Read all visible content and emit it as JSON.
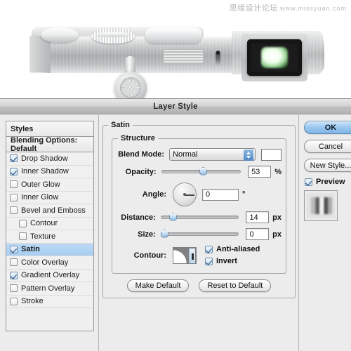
{
  "watermark": {
    "cn_text": "思缘设计论坛",
    "url_text": "www.missyuan.com"
  },
  "artwork": {
    "name": "silver-camera-photo",
    "description": "Silver compact camera top body with dials, strap lug and green-glowing viewfinder"
  },
  "dialog": {
    "title": "Layer Style",
    "styles_panel": {
      "header": "Styles",
      "blending_options": "Blending Options: Default",
      "items": [
        {
          "label": "Drop Shadow",
          "checked": true,
          "sub": false,
          "selected": false
        },
        {
          "label": "Inner Shadow",
          "checked": true,
          "sub": false,
          "selected": false
        },
        {
          "label": "Outer Glow",
          "checked": false,
          "sub": false,
          "selected": false
        },
        {
          "label": "Inner Glow",
          "checked": false,
          "sub": false,
          "selected": false
        },
        {
          "label": "Bevel and Emboss",
          "checked": false,
          "sub": false,
          "selected": false
        },
        {
          "label": "Contour",
          "checked": false,
          "sub": true,
          "selected": false
        },
        {
          "label": "Texture",
          "checked": false,
          "sub": true,
          "selected": false
        },
        {
          "label": "Satin",
          "checked": true,
          "sub": false,
          "selected": true
        },
        {
          "label": "Color Overlay",
          "checked": false,
          "sub": false,
          "selected": false
        },
        {
          "label": "Gradient Overlay",
          "checked": true,
          "sub": false,
          "selected": false
        },
        {
          "label": "Pattern Overlay",
          "checked": false,
          "sub": false,
          "selected": false
        },
        {
          "label": "Stroke",
          "checked": false,
          "sub": false,
          "selected": false
        }
      ]
    },
    "satin": {
      "group_title": "Satin",
      "structure_title": "Structure",
      "blend_mode": {
        "label": "Blend Mode:",
        "value": "Normal",
        "swatch_color": "#ffffff"
      },
      "opacity": {
        "label": "Opacity:",
        "value": "53",
        "unit": "%",
        "slider_percent": 53
      },
      "angle": {
        "label": "Angle:",
        "value": "0",
        "unit": "°",
        "degrees": 0
      },
      "distance": {
        "label": "Distance:",
        "value": "14",
        "unit": "px",
        "slider_percent": 13
      },
      "size": {
        "label": "Size:",
        "value": "0",
        "unit": "px",
        "slider_percent": 0
      },
      "contour": {
        "label": "Contour:",
        "anti_aliased_label": "Anti-aliased",
        "anti_aliased_checked": true,
        "invert_label": "Invert",
        "invert_checked": true
      },
      "make_default": "Make Default",
      "reset_to_default": "Reset to Default"
    },
    "buttons": {
      "ok": "OK",
      "cancel": "Cancel",
      "new_style": "New Style...",
      "preview_label": "Preview",
      "preview_checked": true
    }
  },
  "colors": {
    "dialog_bg": "#ececec",
    "selection_blue": "#a8cef2",
    "accent_blue": "#7fb4e8",
    "titlebar_gray": "#c0c0c0"
  }
}
